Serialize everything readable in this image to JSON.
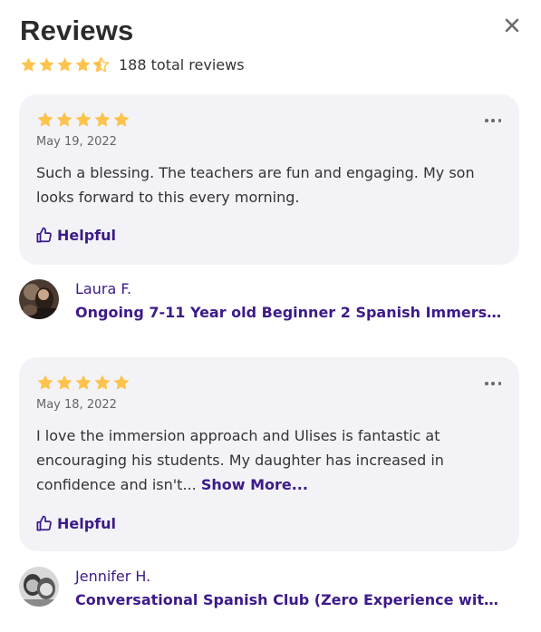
{
  "header": {
    "title": "Reviews",
    "close_icon": "close-icon",
    "summary": {
      "rating": 4.5,
      "rating_max": 5,
      "count_text": "188 total reviews"
    }
  },
  "colors": {
    "star": "#fec34d",
    "accent": "#3c1a8a",
    "card_bg": "#f3f3f7"
  },
  "reviews": [
    {
      "rating": 5,
      "date": "May 19, 2022",
      "text": "Such a blessing. The teachers are fun and engaging. My son looks forward to this every morning.",
      "show_more": "",
      "helpful_label": "Helpful",
      "reviewer_name": "Laura F.",
      "course": "Ongoing 7-11 Year old Beginner 2 Spanish Immersion -..."
    },
    {
      "rating": 5,
      "date": "May 18, 2022",
      "text": "I love the immersion approach and Ulises is fantastic at encouraging his students. My daughter has increased in confidence and isn't...",
      "show_more": "Show More...",
      "helpful_label": "Helpful",
      "reviewer_name": "Jennifer H.",
      "course": "Conversational Spanish Club (Zero Experience with Sp..."
    }
  ]
}
